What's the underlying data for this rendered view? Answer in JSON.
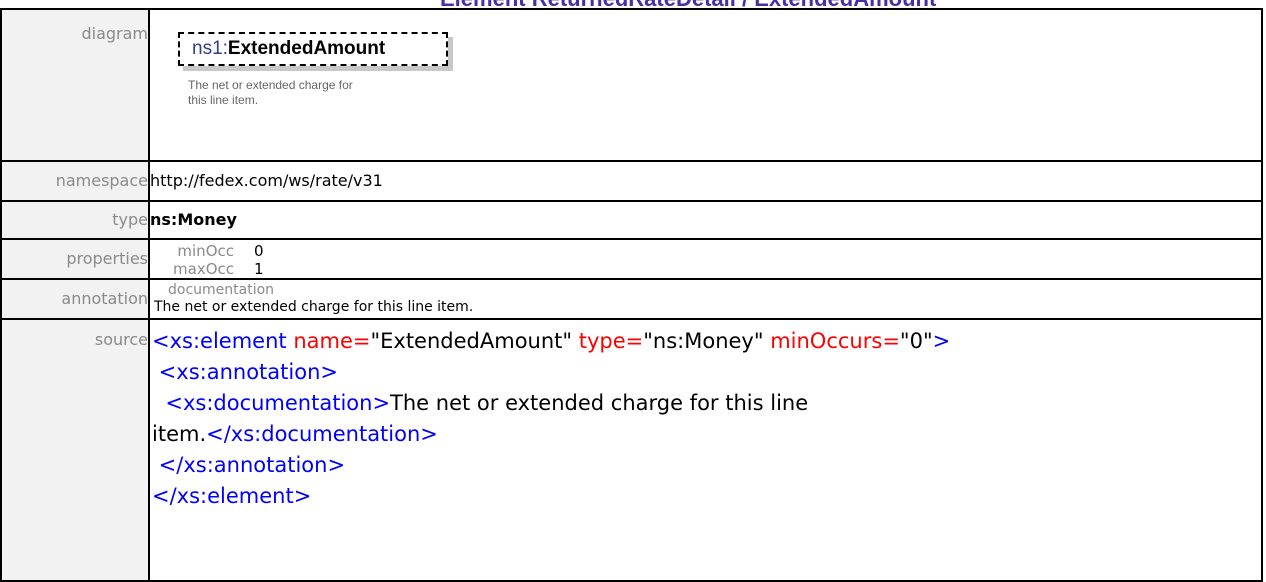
{
  "page_title": "Element ReturnedRateDetail / ExtendedAmount",
  "rows": {
    "diagram": {
      "label": "diagram",
      "element_prefix": "ns1:",
      "element_name": "ExtendedAmount",
      "doc_text": "The net or extended charge for this line item."
    },
    "namespace": {
      "label": "namespace",
      "value": "http://fedex.com/ws/rate/v31"
    },
    "type": {
      "label": "type",
      "value": "ns:Money"
    },
    "properties": {
      "label": "properties",
      "items": [
        {
          "key": "minOcc",
          "value": "0"
        },
        {
          "key": "maxOcc",
          "value": "1"
        }
      ]
    },
    "annotation": {
      "label": "annotation",
      "heading": "documentation",
      "text": "The net or extended charge for this line item."
    },
    "source": {
      "label": "source",
      "lines": {
        "l1_open": "<xs:element ",
        "l1_attr1": "name=",
        "l1_val1": "\"ExtendedAmount\"",
        "l1_attr2": " type=",
        "l1_val2": "\"ns:Money\"",
        "l1_attr3": " minOccurs=",
        "l1_val3": "\"0\"",
        "l1_close": ">",
        "l2": " <xs:annotation>",
        "l3_open": "  <xs:documentation>",
        "l3_text": "The net or extended charge for this line",
        "l4_text": "item.",
        "l4_close": "</xs:documentation>",
        "l5": " </xs:annotation>",
        "l6": "</xs:element>"
      }
    }
  },
  "colors": {
    "label_bg": "#f2f2f2",
    "label_text": "#8a8a8a",
    "xml_tag": "#0000ff",
    "xml_attr": "#ff0000"
  }
}
